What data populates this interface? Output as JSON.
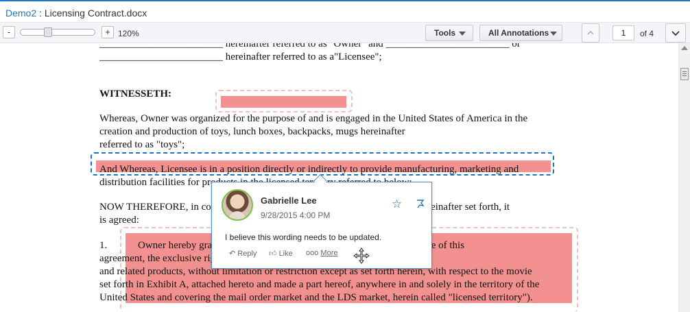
{
  "window": {
    "app_name": "Demo2",
    "separator": " : ",
    "file_name": "Licensing Contract.docx"
  },
  "toolbar": {
    "zoom_out": "-",
    "zoom_in": "+",
    "zoom_level": "120%",
    "zoom_slider_fraction": 0.35,
    "tools_label": "Tools",
    "annotations_label": "All Annotations",
    "page_current": "1",
    "page_total": "of 4"
  },
  "document": {
    "lines": [
      "________________________ hereinafter referred to as \"Owner\" and ________________________ or",
      "________________________ hereinafter referred to as a\"Licensee\";",
      "WITNESSETH:",
      "Whereas, Owner was organized for the purpose of and is engaged in the United States of America in the",
      "creation and production of toys, lunch boxes, backpacks, mugs hereinafter",
      "referred to as \"toys\";",
      "And Whereas, Licensee is in a position directly or indirectly to provide manufacturing, marketing and",
      "distribution facilities for products in the licensed territory referred to below;",
      "NOW THEREFORE, in consideration of the mutual covenants and promises hereinafter set forth, it",
      "is agreed:",
      "1.",
      "Owner hereby grants to Licensee for a period of five years from the date of this",
      "agreement, the exclusive right to manufacture and distribute toys",
      "and related products, without limitation or restriction except as set forth herein, with respect to the movie",
      "set forth in Exhibit A, attached hereto and made a part hereof, anywhere in and solely in the territory of the",
      "United States and covering the mail order market and the LDS market, herein called \"licensed territory\")."
    ]
  },
  "comment": {
    "author": "Gabrielle Lee",
    "date": "9/28/2015 4:00 PM",
    "body": "I believe this wording needs to be updated.",
    "reply": "Reply",
    "like": "Like",
    "more": "More"
  },
  "colors": {
    "accent": "#1e73be",
    "highlight": "#f28b8b",
    "avatar_ring": "#7fbf4d"
  }
}
